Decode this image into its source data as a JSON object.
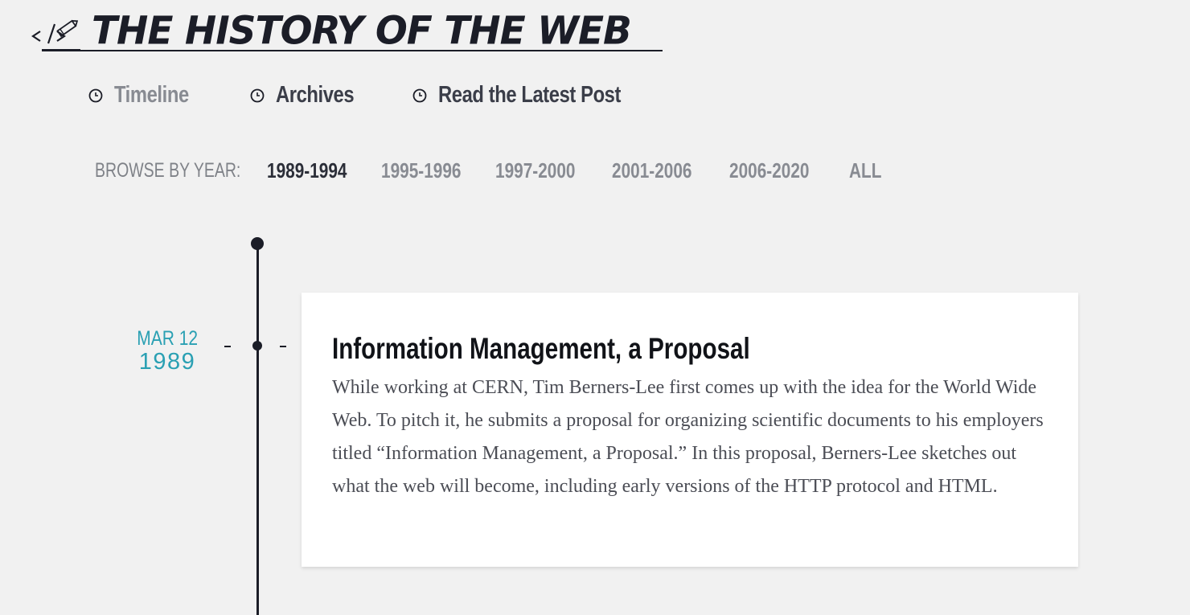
{
  "header": {
    "site_title": "THE HISTORY OF THE WEB",
    "logo_icon": "code-pencil-icon"
  },
  "nav": {
    "items": [
      {
        "label": "Timeline",
        "icon": "clock-bullet-icon",
        "active": true
      },
      {
        "label": "Archives",
        "icon": "clock-bullet-icon",
        "active": false
      },
      {
        "label": "Read the Latest Post",
        "icon": "clock-bullet-icon",
        "active": false
      }
    ]
  },
  "browse": {
    "label": "BROWSE BY YEAR:",
    "years": [
      {
        "label": "1989-1994",
        "selected": true
      },
      {
        "label": "1995-1996",
        "selected": false
      },
      {
        "label": "1997-2000",
        "selected": false
      },
      {
        "label": "2001-2006",
        "selected": false
      },
      {
        "label": "2006-2020",
        "selected": false
      },
      {
        "label": "ALL",
        "selected": false
      }
    ]
  },
  "entry": {
    "month_day": "MAR 12",
    "year": "1989",
    "title": "Information Management, a Proposal",
    "body": "While working at CERN, Tim Berners-Lee first comes up with the idea for the World Wide Web. To pitch it, he submits a proposal for organizing scientific documents to his employers titled “Information Management, a Proposal.” In this proposal, Berners-Lee sketches out what the web will become, including early versions of the HTTP protocol and HTML."
  },
  "colors": {
    "background": "#f1f1f1",
    "text_dark": "#1b1d27",
    "muted": "#888b92",
    "accent_teal": "#2aa0b3",
    "card": "#ffffff"
  }
}
